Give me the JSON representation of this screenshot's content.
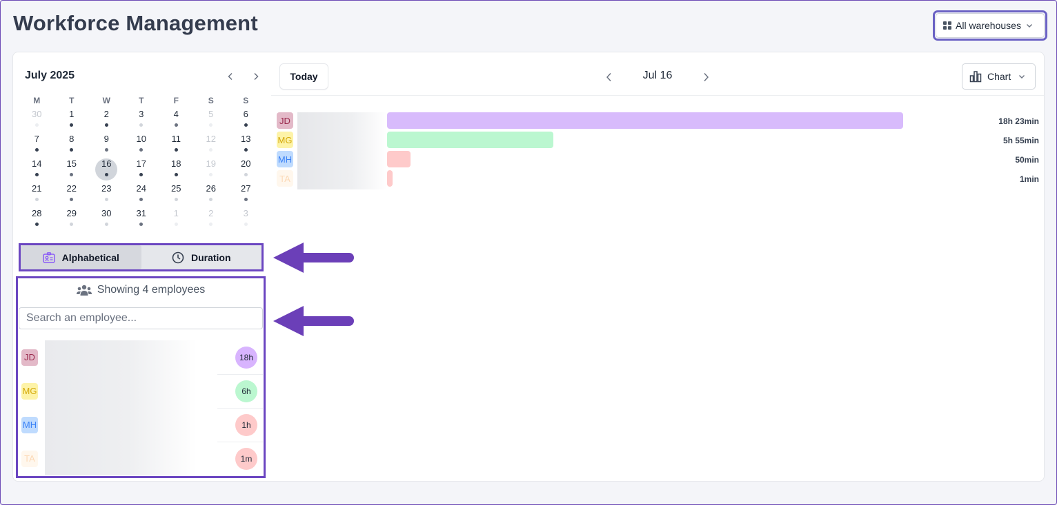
{
  "header": {
    "title": "Workforce Management",
    "warehouse_label": "All warehouses"
  },
  "calendar": {
    "month_label": "July 2025",
    "weekdays": [
      "M",
      "T",
      "W",
      "T",
      "F",
      "S",
      "S"
    ],
    "weeks": [
      [
        {
          "d": "30",
          "muted": true,
          "dot": "faint"
        },
        {
          "d": "1",
          "dot": "dark"
        },
        {
          "d": "2",
          "dot": "dark"
        },
        {
          "d": "3",
          "dot": "light"
        },
        {
          "d": "4",
          "dot": "mid"
        },
        {
          "d": "5",
          "muted": true,
          "dot": "faint"
        },
        {
          "d": "6",
          "dot": "dark"
        }
      ],
      [
        {
          "d": "7",
          "dot": "dark"
        },
        {
          "d": "8",
          "dot": "dark"
        },
        {
          "d": "9",
          "dot": "mid"
        },
        {
          "d": "10",
          "dot": "mid"
        },
        {
          "d": "11",
          "dot": "dark"
        },
        {
          "d": "12",
          "muted": true,
          "dot": "faint"
        },
        {
          "d": "13",
          "dot": "dark"
        }
      ],
      [
        {
          "d": "14",
          "dot": "dark"
        },
        {
          "d": "15",
          "dot": "mid"
        },
        {
          "d": "16",
          "dot": "dark",
          "selected": true
        },
        {
          "d": "17",
          "dot": "dark"
        },
        {
          "d": "18",
          "dot": "dark"
        },
        {
          "d": "19",
          "muted": true,
          "dot": "faint"
        },
        {
          "d": "20",
          "dot": "light"
        }
      ],
      [
        {
          "d": "21",
          "dot": "light"
        },
        {
          "d": "22",
          "dot": "mid"
        },
        {
          "d": "23",
          "dot": "light"
        },
        {
          "d": "24",
          "dot": "mid"
        },
        {
          "d": "25",
          "dot": "light"
        },
        {
          "d": "26",
          "dot": "light"
        },
        {
          "d": "27",
          "dot": "mid"
        }
      ],
      [
        {
          "d": "28",
          "dot": "dark"
        },
        {
          "d": "29",
          "dot": "light"
        },
        {
          "d": "30",
          "dot": "light"
        },
        {
          "d": "31",
          "dot": "mid"
        },
        {
          "d": "1",
          "muted": true,
          "dot": "faint"
        },
        {
          "d": "2",
          "muted": true,
          "dot": "faint"
        },
        {
          "d": "3",
          "muted": true,
          "dot": "faint"
        }
      ]
    ]
  },
  "sort": {
    "alphabetical_label": "Alphabetical",
    "duration_label": "Duration",
    "active": "alphabetical"
  },
  "employees_panel": {
    "count_label": "Showing 4 employees",
    "search_placeholder": "Search an employee...",
    "items": [
      {
        "initials": "JD",
        "hours": "18h",
        "avatar_bg": "#e3b9c8",
        "avatar_fg": "#9b2c4f",
        "pill_bg": "#d8b4fe"
      },
      {
        "initials": "MG",
        "hours": "6h",
        "avatar_bg": "#fdf3a8",
        "avatar_fg": "#d4a90a",
        "pill_bg": "#bbf7d0"
      },
      {
        "initials": "MH",
        "hours": "1h",
        "avatar_bg": "#bfdbfe",
        "avatar_fg": "#3b82f6",
        "pill_bg": "#fecaca"
      },
      {
        "initials": "TA",
        "hours": "1m",
        "avatar_bg": "#fff7ed",
        "avatar_fg": "#fcd9b6",
        "pill_bg": "#fecaca"
      }
    ]
  },
  "toolbar": {
    "today_label": "Today",
    "date_label": "Jul 16",
    "view_label": "Chart"
  },
  "chart_data": {
    "type": "bar",
    "orientation": "horizontal",
    "categories": [
      "JD",
      "MG",
      "MH",
      "TA"
    ],
    "values_minutes": [
      1103,
      355,
      50,
      1
    ],
    "value_labels": [
      "18h 23min",
      "5h 55min",
      "50min",
      "1min"
    ],
    "colors": [
      "#d8bbfc",
      "#bbf7d0",
      "#fecaca",
      "#fecaca"
    ]
  },
  "colors": {
    "accent_outline": "#6b46c1",
    "arrow": "#6b3fb8"
  }
}
